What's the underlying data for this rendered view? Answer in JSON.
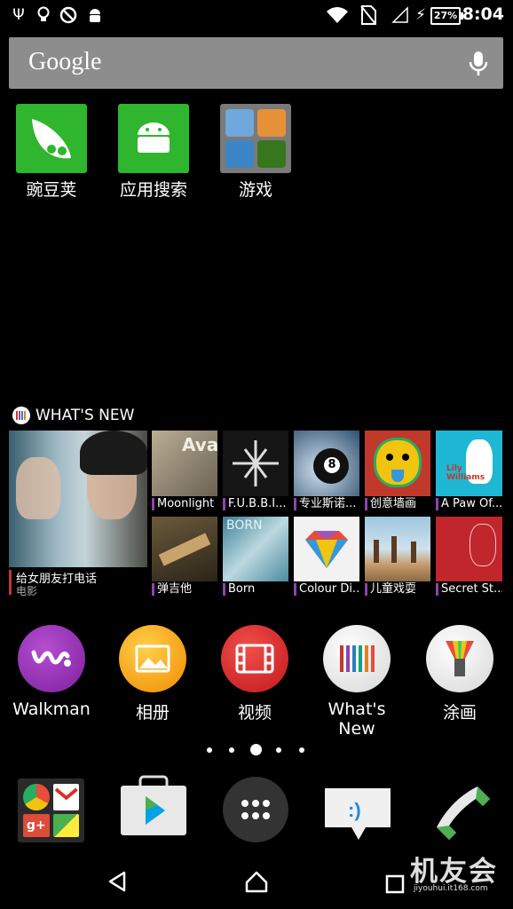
{
  "status_bar": {
    "battery": "27%",
    "time": "8:04"
  },
  "search": {
    "logo": "Google"
  },
  "apps": [
    {
      "label": "豌豆荚"
    },
    {
      "label": "应用搜索"
    },
    {
      "label": "游戏"
    }
  ],
  "whats_new": {
    "title": "WHAT'S NEW",
    "large": {
      "title": "给女朋友打电话",
      "subtitle": "电影"
    },
    "tiles": [
      {
        "caption": "Moonlight"
      },
      {
        "caption": "F.U.B.B.I..."
      },
      {
        "caption": "专业斯诺..."
      },
      {
        "caption": "创意墙画"
      },
      {
        "caption": "A Paw Of..."
      },
      {
        "caption": "弹吉他"
      },
      {
        "caption": "Born"
      },
      {
        "caption": "Colour Di..."
      },
      {
        "caption": "儿童戏耍"
      },
      {
        "caption": "Secret St..."
      }
    ],
    "art_text": {
      "ava": "Ava",
      "born": "BORN",
      "lily": "Lily Williams"
    }
  },
  "dock_apps": [
    {
      "label": "Walkman"
    },
    {
      "label": "相册"
    },
    {
      "label": "视频"
    },
    {
      "label": "What's New"
    },
    {
      "label": "涂画"
    }
  ],
  "watermark": {
    "brand": "机友会",
    "url": "jiyouhui.it168.com"
  }
}
